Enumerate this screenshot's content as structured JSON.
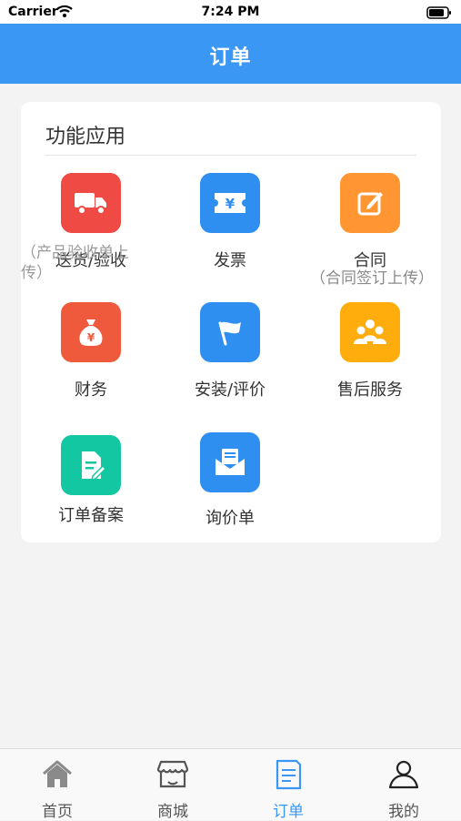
{
  "status_bar": {
    "carrier": "Carrier",
    "time": "7:24 PM"
  },
  "header": {
    "title": "订单"
  },
  "card": {
    "title": "功能应用",
    "items": [
      {
        "label": "送货/验收",
        "note": "（产品验收单上传）",
        "icon": "truck-icon",
        "color": "#ef4a43"
      },
      {
        "label": "发票",
        "icon": "invoice-ticket-icon",
        "color": "#2f8ff0"
      },
      {
        "label": "合同",
        "note": "（合同签订上传）",
        "icon": "edit-icon",
        "color": "#ff9632"
      },
      {
        "label": "财务",
        "icon": "money-bag-icon",
        "color": "#ef5a3c"
      },
      {
        "label": "安装/评价",
        "icon": "flag-icon",
        "color": "#2f8ff0"
      },
      {
        "label": "售后服务",
        "icon": "people-icon",
        "color": "#ffac0d"
      },
      {
        "label": "订单备案",
        "icon": "document-icon",
        "color": "#13c7a2"
      },
      {
        "label": "询价单",
        "icon": "mail-letter-icon",
        "color": "#2f8ff0"
      }
    ]
  },
  "tab_bar": {
    "tabs": [
      {
        "label": "首页",
        "icon": "home-icon"
      },
      {
        "label": "商城",
        "icon": "store-icon"
      },
      {
        "label": "订单",
        "icon": "order-icon",
        "active": true
      },
      {
        "label": "我的",
        "icon": "user-icon"
      }
    ]
  },
  "colors": {
    "accent": "#3a97f3",
    "background": "#f3f3f3",
    "card": "#ffffff"
  }
}
